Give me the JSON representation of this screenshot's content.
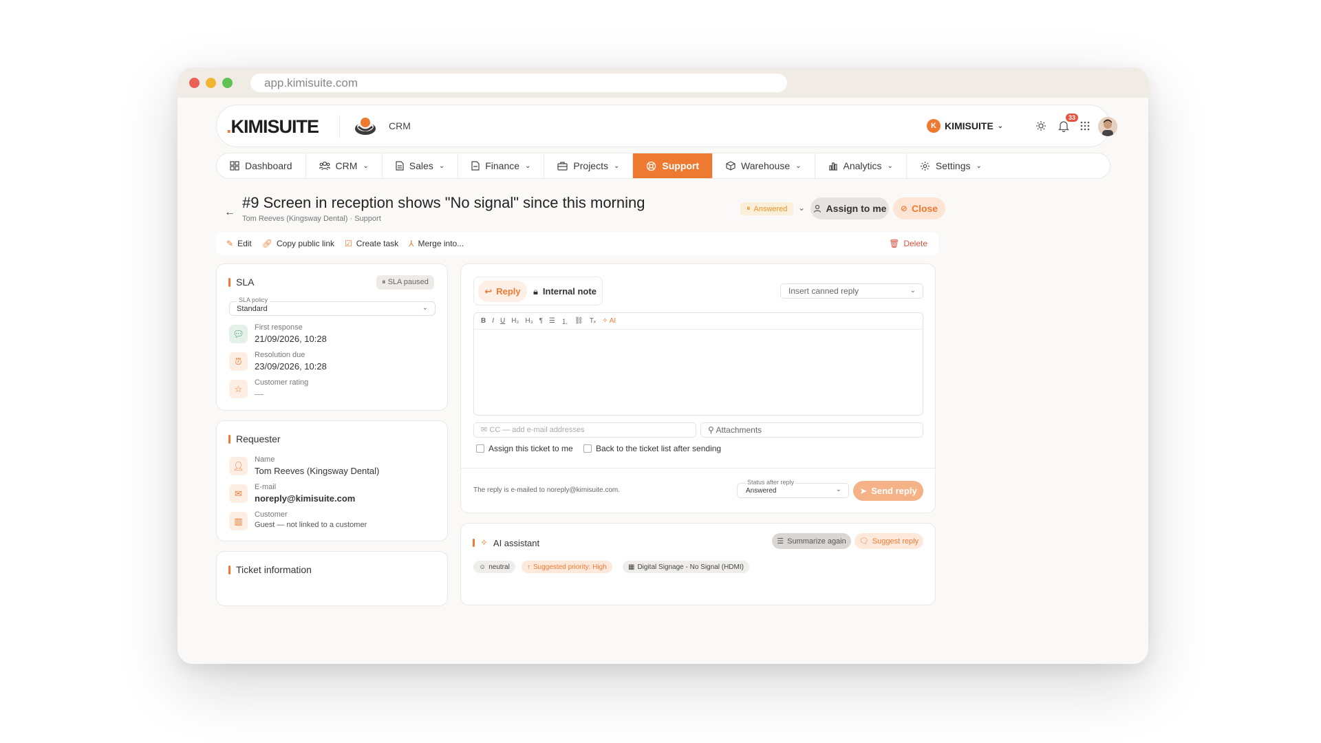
{
  "browser": {
    "url": "app.kimisuite.com"
  },
  "header": {
    "brand": "KIMISUITE",
    "module": "CRM",
    "org_initial": "K",
    "org_name": "KIMISUITE",
    "notifications_count": "33"
  },
  "nav": {
    "items": [
      {
        "label": "Dashboard",
        "icon": "dashboard-icon"
      },
      {
        "label": "CRM",
        "icon": "users-icon"
      },
      {
        "label": "Sales",
        "icon": "document-icon"
      },
      {
        "label": "Finance",
        "icon": "file-icon"
      },
      {
        "label": "Projects",
        "icon": "briefcase-icon"
      },
      {
        "label": "Support",
        "icon": "lifebuoy-icon",
        "active": true
      },
      {
        "label": "Warehouse",
        "icon": "box-icon"
      },
      {
        "label": "Analytics",
        "icon": "chart-icon"
      },
      {
        "label": "Settings",
        "icon": "gear-icon"
      }
    ]
  },
  "ticket": {
    "title": "#9 Screen in reception shows \"No signal\" since this morning",
    "subtitle": "Tom Reeves (Kingsway Dental) · Support",
    "status_badge": "Answered",
    "assign_label": "Assign to me",
    "close_label": "Close"
  },
  "actions": {
    "edit": "Edit",
    "copy_link": "Copy public link",
    "create_task": "Create task",
    "merge": "Merge into...",
    "delete": "Delete"
  },
  "sla": {
    "title": "SLA",
    "paused": "SLA paused",
    "policy_label": "SLA policy",
    "policy_value": "Standard",
    "first_response_label": "First response",
    "first_response_value": "21/09/2026, 10:28",
    "resolution_label": "Resolution due",
    "resolution_value": "23/09/2026, 10:28",
    "rating_label": "Customer rating",
    "rating_value": "—"
  },
  "requester": {
    "title": "Requester",
    "name_label": "Name",
    "name_value": "Tom Reeves (Kingsway Dental)",
    "email_label": "E-mail",
    "email_value": "noreply@kimisuite.com",
    "customer_label": "Customer",
    "customer_value": "Guest — not linked to a customer"
  },
  "ticket_info": {
    "title": "Ticket information"
  },
  "reply": {
    "tab_reply": "Reply",
    "tab_note": "Internal note",
    "canned_placeholder": "Insert canned reply",
    "toolbar": [
      "B",
      "I",
      "U",
      "H₂",
      "H₃",
      "¶",
      "☰",
      "⒈",
      "⛓",
      "Tₓ"
    ],
    "toolbar_ai": "AI",
    "cc_placeholder": "CC — add e-mail addresses",
    "attachments": "Attachments",
    "chk_assign": "Assign this ticket to me",
    "chk_back": "Back to the ticket list after sending",
    "note": "The reply is e-mailed to noreply@kimisuite.com.",
    "status_label": "Status after reply",
    "status_value": "Answered",
    "send_label": "Send reply"
  },
  "ai": {
    "title": "AI assistant",
    "summarize": "Summarize again",
    "suggest": "Suggest reply",
    "chips": [
      "neutral",
      "Suggested priority: High",
      "Digital Signage - No Signal (HDMI)"
    ]
  },
  "colors": {
    "accent": "#ee7a32",
    "danger": "#d8523e"
  }
}
